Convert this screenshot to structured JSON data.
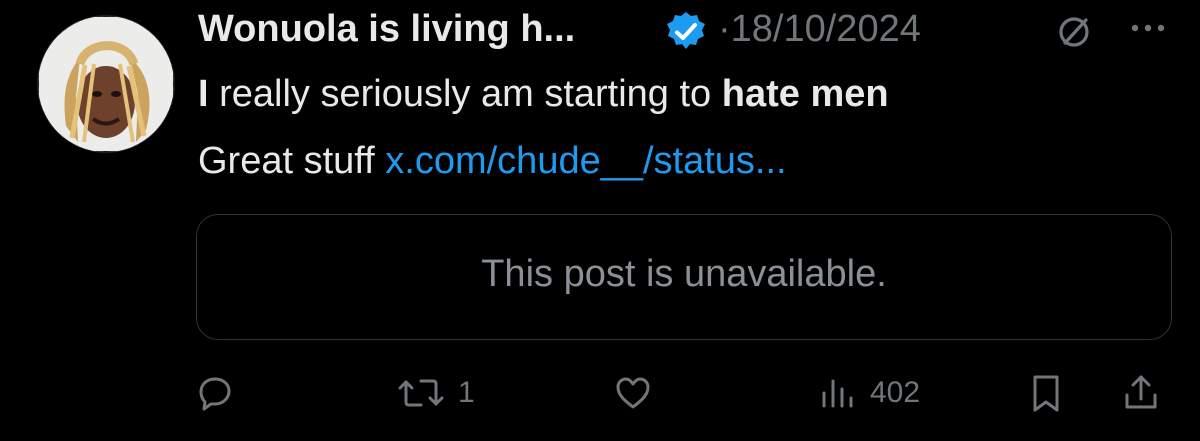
{
  "post": {
    "author": {
      "display_name": "Wonuola is living h...",
      "verified": true,
      "avatar_icon": "profile-photo"
    },
    "separator": "·",
    "date": "18/10/2024",
    "text": {
      "line1_start": "I",
      "line1_middle": " really seriously am starting to ",
      "line1_bold": "hate men",
      "line2_text": "Great stuff ",
      "line2_link": "x.com/chude__/status..."
    },
    "quote": {
      "message": "This post is unavailable."
    },
    "stats": {
      "replies": "",
      "reposts": "1",
      "likes": "",
      "views": "402"
    }
  },
  "colors": {
    "background": "#000000",
    "primary_text": "#e7e9ea",
    "secondary_text": "#71767b",
    "link": "#1d9bf0",
    "verified_badge": "#1d9bf0",
    "border": "#2f3336"
  },
  "icons": {
    "verified": "verified-badge-icon",
    "grok": "grok-icon",
    "more": "more-icon",
    "reply": "reply-icon",
    "repost": "repost-icon",
    "like": "like-icon",
    "views": "views-icon",
    "bookmark": "bookmark-icon",
    "share": "share-icon"
  }
}
